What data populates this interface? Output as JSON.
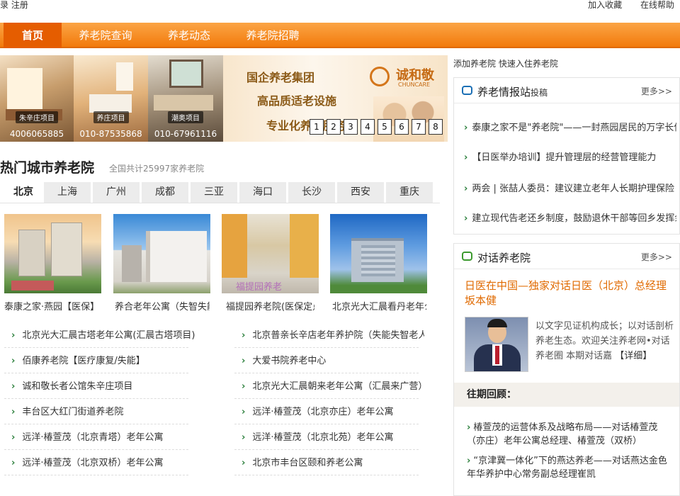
{
  "topbar": {
    "left_text": "录  注册",
    "add_favorite": "加入收藏",
    "online_help": "在线帮助"
  },
  "nav": {
    "items": [
      "首页",
      "养老院查询",
      "养老动态",
      "养老院招聘"
    ]
  },
  "banner": {
    "photos": [
      {
        "caption": "朱辛庄项目",
        "phone": "4006065885"
      },
      {
        "caption": "养庄项目",
        "phone": "010-87535868"
      },
      {
        "caption": "潮奥项目",
        "phone": "010-67961116"
      }
    ],
    "slogans": [
      "国企养老集团",
      "高品质适老设施",
      "专业化养老服务"
    ],
    "brand": "诚和敬",
    "brand_sub": "CHUNCARE",
    "pages": [
      "1",
      "2",
      "3",
      "4",
      "5",
      "6",
      "7",
      "8"
    ]
  },
  "hot_cities": {
    "title": "热门城市养老院",
    "count_text": "全国共计25997家养老院",
    "tabs": [
      "北京",
      "上海",
      "广州",
      "成都",
      "三亚",
      "海口",
      "长沙",
      "西安",
      "重庆"
    ],
    "thumbs": [
      {
        "caption": "泰康之家·燕园【医保】"
      },
      {
        "caption": "养合老年公寓（失智失能）"
      },
      {
        "caption": "福提园养老院(医保定点)"
      },
      {
        "caption": "北京光大汇晨看丹老年公寓"
      }
    ],
    "thumb_watermark": "福提园养老",
    "links_left": [
      "北京光大汇晨古塔老年公寓(汇晨古塔项目)",
      "佰康养老院【医疗康复/失能】",
      "诚和敬长者公馆朱辛庄项目",
      "丰台区大红门街道养老院",
      "远洋·椿萱茂（北京青塔）老年公寓",
      "远洋·椿萱茂（北京双桥）老年公寓"
    ],
    "links_right": [
      "北京普亲长辛店老年养护院（失能失智老人）",
      "大爱书院养老中心",
      "北京光大汇晨朝来老年公寓（汇晨来广营）",
      "远洋·椿萱茂（北京亦庄）老年公寓",
      "远洋·椿萱茂（北京北苑）老年公寓",
      "北京市丰台区颐和养老公寓"
    ]
  },
  "sidebar": {
    "top_text": "添加养老院 快速入住养老院",
    "news_box": {
      "title": "养老情报站",
      "title_suffix": "投稿",
      "more": "更多>>",
      "items": [
        "泰康之家不是\"养老院\"——一封燕园居民的万字长信",
        "【日医举办培训】提升管理层的经营管理能力",
        "两会 | 张喆人委员：建议建立老年人长期护理保险",
        "建立现代告老还乡制度，鼓励退休干部等回乡发挥余热"
      ]
    },
    "dialog_box": {
      "title": "对话养老院",
      "more": "更多>>",
      "feature_title": "日医在中国—独家对话日医（北京）总经理坂本健",
      "feature_desc": "以文字见证机构成长；以对话剖析养老生态。欢迎关注养老网•对话养老圈 本期对话嘉",
      "detail": "【详细】",
      "past_head": "往期回顾：",
      "past_items": [
        "椿萱茂的运营体系及战略布局——对话椿萱茂（亦庄）老年公寓总经理、椿萱茂（双桥）",
        "“京津冀一体化”下的燕达养老——对话燕达金色年华养护中心常务副总经理崔凯"
      ]
    }
  }
}
